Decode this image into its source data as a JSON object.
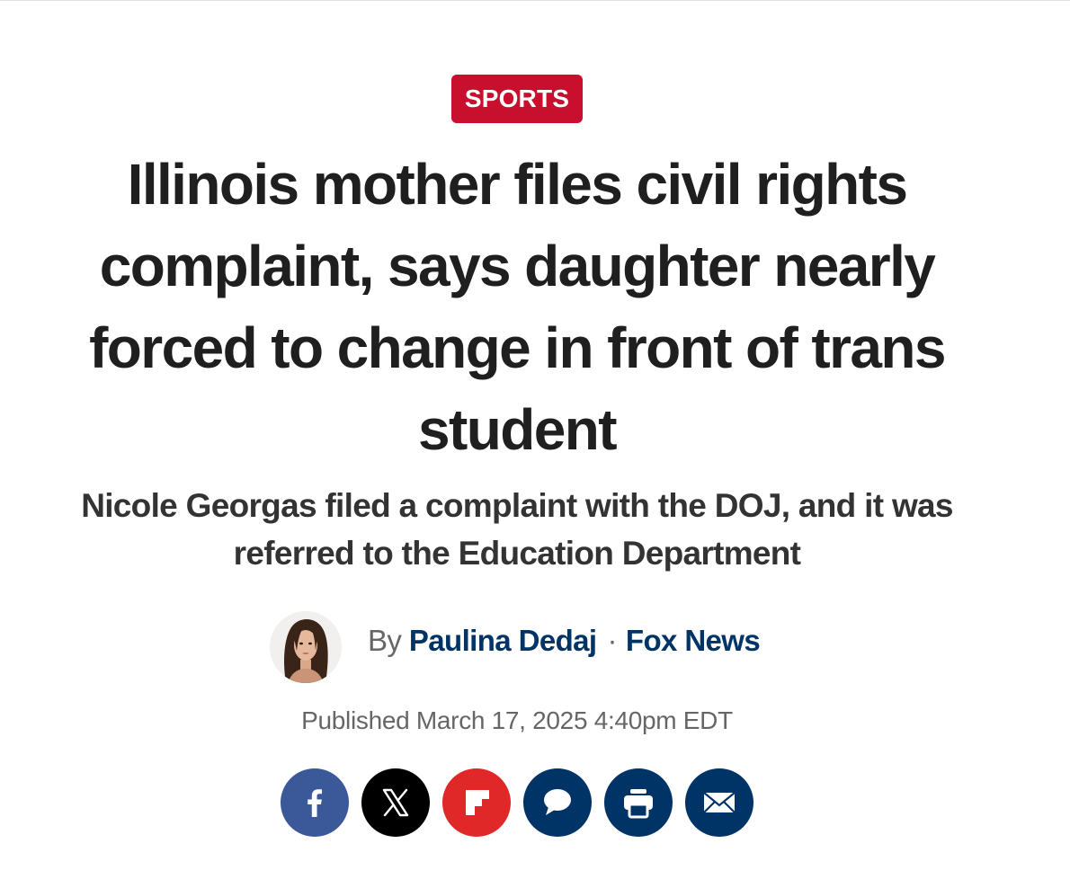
{
  "article": {
    "category": "SPORTS",
    "headline": "Illinois mother files civil rights complaint, says daughter nearly forced to change in front of trans student",
    "subheadline": "Nicole Georgas filed a complaint with the DOJ, and it was referred to the Education Department",
    "byline": {
      "prefix": "By",
      "author": "Paulina Dedaj",
      "separator": "·",
      "publisher": "Fox News"
    },
    "published": "Published March 17, 2025 4:40pm EDT"
  },
  "share": {
    "buttons": [
      {
        "name": "facebook",
        "icon": "facebook-icon",
        "color": "#3b5998"
      },
      {
        "name": "x",
        "icon": "x-icon",
        "color": "#000000"
      },
      {
        "name": "flipboard",
        "icon": "flipboard-icon",
        "color": "#e12828"
      },
      {
        "name": "comments",
        "icon": "comment-icon",
        "color": "#003366"
      },
      {
        "name": "print",
        "icon": "print-icon",
        "color": "#003366"
      },
      {
        "name": "email",
        "icon": "email-icon",
        "color": "#003366"
      }
    ]
  },
  "colors": {
    "category_badge": "#c8102e",
    "headline_text": "#1f1f1f",
    "link_navy": "#003366",
    "meta_gray": "#666666"
  }
}
